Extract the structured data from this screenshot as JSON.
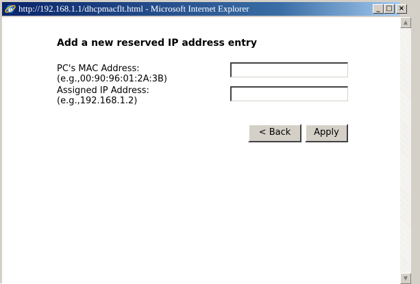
{
  "window": {
    "title": "http://192.168.1.1/dhcpmacflt.html - Microsoft Internet Explorer",
    "buttons": {
      "minimize": "_",
      "maximize": "□",
      "close": "×"
    }
  },
  "form": {
    "heading": "Add a new reserved IP address entry",
    "mac_label": "PC's MAC Address:",
    "mac_example": "(e.g.,00:90:96:01:2A:3B)",
    "mac_value": "",
    "ip_label": "Assigned IP Address:",
    "ip_example": "(e.g.,192.168.1.2)",
    "ip_value": ""
  },
  "actions": {
    "back_label": "< Back",
    "apply_label": "Apply"
  },
  "scrollbar": {
    "up_arrow": "▲",
    "down_arrow": "▼"
  },
  "colors": {
    "titlebar_start": "#0a246a",
    "titlebar_end": "#a6caf0",
    "chrome": "#d4d0c8"
  }
}
